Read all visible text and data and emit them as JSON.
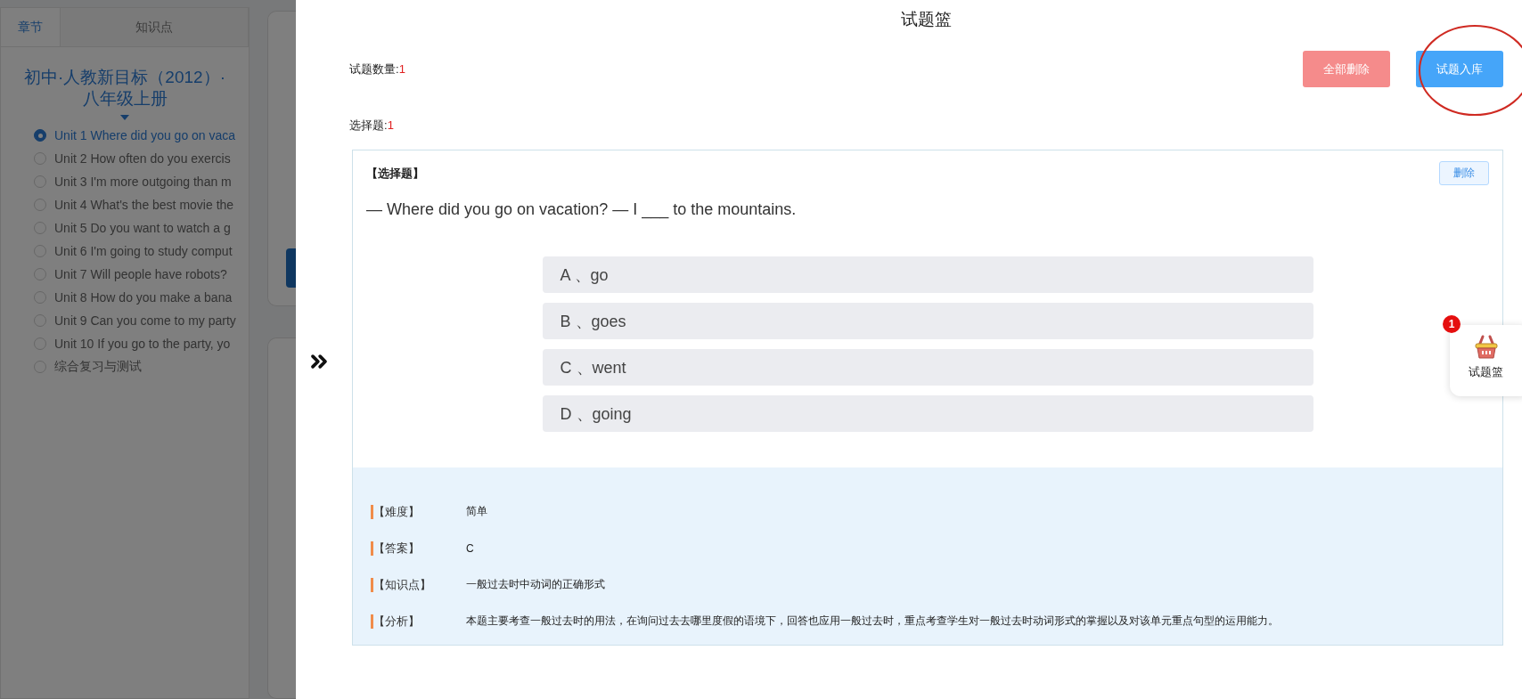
{
  "sidebar": {
    "tabs": [
      {
        "label": "章节",
        "selected": true
      },
      {
        "label": "知识点",
        "selected": false
      }
    ],
    "book_title": "初中·人教新目标（2012）·八年级上册",
    "units": [
      {
        "label": "Unit 1 Where did you go on vaca",
        "selected": true
      },
      {
        "label": "Unit 2 How often do you exercis",
        "selected": false
      },
      {
        "label": "Unit 3 I'm more outgoing than m",
        "selected": false
      },
      {
        "label": "Unit 4 What's the best movie the",
        "selected": false
      },
      {
        "label": "Unit 5 Do you want to watch a g",
        "selected": false
      },
      {
        "label": "Unit 6 I'm going to study comput",
        "selected": false
      },
      {
        "label": "Unit 7 Will people have robots?",
        "selected": false
      },
      {
        "label": "Unit 8 How do you make a bana",
        "selected": false
      },
      {
        "label": "Unit 9 Can you come to my party",
        "selected": false
      },
      {
        "label": "Unit 10 If you go to the party, yo",
        "selected": false
      },
      {
        "label": "综合复习与测试",
        "selected": false
      }
    ]
  },
  "drawer": {
    "title": "试题篮",
    "count_label": "试题数量:",
    "count": "1",
    "buttons": [
      {
        "label": "全部删除",
        "kind": "danger",
        "circled": false
      },
      {
        "label": "试题入库",
        "kind": "primary",
        "circled": true
      }
    ],
    "sections": [
      {
        "label": "选择题:",
        "count": "1",
        "questions": [
          {
            "type_label": "【选择题】",
            "delete_label": "删除",
            "stem": "— Where did you go on vacation? — I ___ to the mountains.",
            "options": [
              "A 、go",
              "B 、goes",
              "C 、went",
              "D 、going"
            ],
            "details": [
              {
                "label": "【难度】",
                "value": "简单"
              },
              {
                "label": "【答案】",
                "value": "C"
              },
              {
                "label": "【知识点】",
                "value": "一般过去时中动词的正确形式"
              },
              {
                "label": "【分析】",
                "value": "本题主要考查一般过去时的用法，在询问过去去哪里度假的语境下，回答也应用一般过去时，重点考查学生对一般过去时动词形式的掌握以及对该单元重点句型的运用能力。"
              }
            ]
          }
        ]
      }
    ]
  },
  "basket": {
    "badge": "1",
    "label": "试题篮"
  }
}
